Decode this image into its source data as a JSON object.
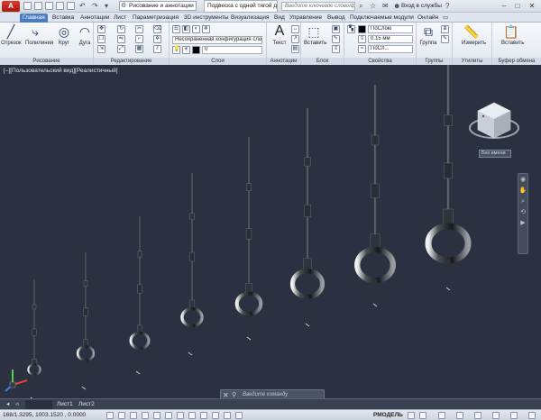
{
  "titlebar": {
    "logo": "A",
    "workspace": "Рисование и аннотации",
    "doc_title": "Подвеска с одной тягой д...",
    "search_placeholder": "Введите ключевое слово/фразу",
    "login": "Вход в службы"
  },
  "tabs": [
    "Главная",
    "Вставка",
    "Аннотации",
    "Лист",
    "Параметризация",
    "3D инструменты",
    "Визуализация",
    "Вид",
    "Управление",
    "Вывод",
    "Подключаемые модули",
    "Онлайн"
  ],
  "ribbon": {
    "draw": {
      "title": "Рисование",
      "line": "Отрезок",
      "polyline": "Полилиния",
      "circle": "Круг",
      "arc": "Дуга"
    },
    "modify": {
      "title": "Редактирование"
    },
    "layers": {
      "title": "Слои",
      "state": "Несохраненная конфигурация сло",
      "current": "0"
    },
    "annotation": {
      "title": "Аннотации",
      "text": "Текст"
    },
    "block": {
      "title": "Блок",
      "insert": "Вставить"
    },
    "properties": {
      "title": "Свойства",
      "color": "ПоСлою",
      "lineweight": "0.15 мм",
      "linetype": "ПоСл..."
    },
    "groups": {
      "title": "Группы",
      "group": "Группа"
    },
    "utilities": {
      "title": "Утилиты",
      "measure": "Измерить"
    },
    "clipboard": {
      "title": "Буфер обмена",
      "paste": "Вставить"
    }
  },
  "viewport": {
    "label": "[–][Пользовательский вид][Реалистичный]",
    "viewcube_label": "Без имени"
  },
  "command": {
    "placeholder": "Введите команду"
  },
  "layout_tabs": [
    "Лист1",
    "Лист2"
  ],
  "status": {
    "coords": "168/1.3295, 1003.1520 , 0.0000",
    "model": "РМОДЕЛЬ"
  },
  "colors": {
    "background": "#2b3140",
    "accent": "#4b7cc2",
    "logo": "#d12c20"
  }
}
